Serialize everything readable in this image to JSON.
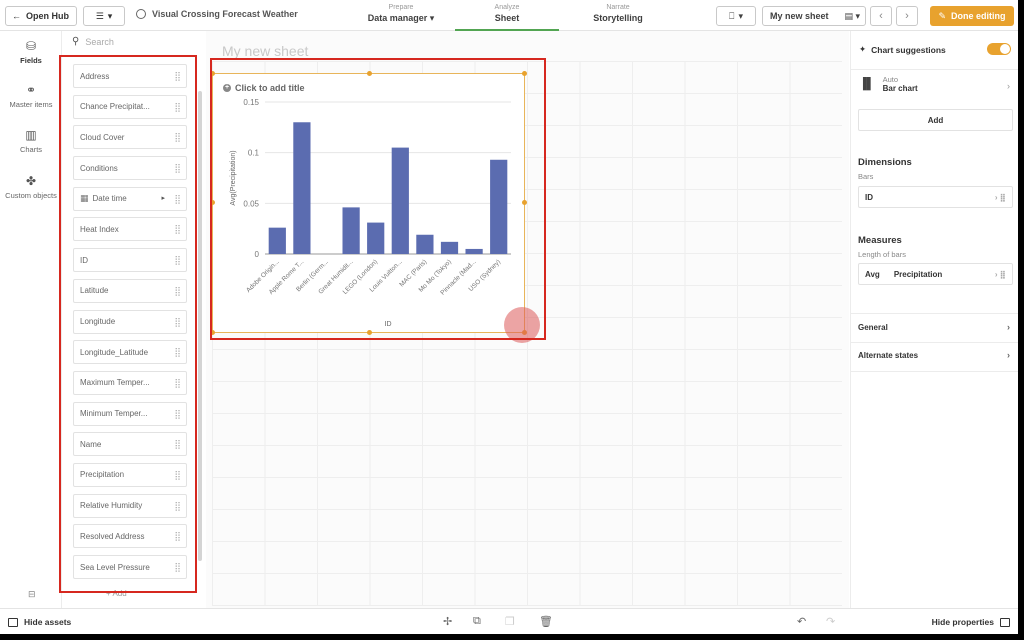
{
  "topbar": {
    "open_hub": "Open Hub",
    "app_title": "Visual Crossing Forecast Weather",
    "tabs": [
      {
        "small": "Prepare",
        "big": "Data manager",
        "caret": "▾"
      },
      {
        "small": "Analyze",
        "big": "Sheet"
      },
      {
        "small": "Narrate",
        "big": "Storytelling"
      }
    ],
    "sheet_name": "My new sheet",
    "done_editing": "Done editing"
  },
  "rail": {
    "items": [
      {
        "label": "Fields",
        "icon": "database-icon"
      },
      {
        "label": "Master items",
        "icon": "link-icon"
      },
      {
        "label": "Charts",
        "icon": "chart-icon"
      },
      {
        "label": "Custom objects",
        "icon": "puzzle-icon"
      }
    ]
  },
  "fields_panel": {
    "search_placeholder": "Search",
    "fields": [
      "Address",
      "Chance Precipitat...",
      "Cloud Cover",
      "Conditions",
      "Date time",
      "Heat Index",
      "ID",
      "Latitude",
      "Longitude",
      "Longitude_Latitude",
      "Maximum Temper...",
      "Minimum Temper...",
      "Name",
      "Precipitation",
      "Relative Humidity",
      "Resolved Address",
      "Sea Level Pressure"
    ],
    "add_label": "Add"
  },
  "canvas": {
    "sheet_title": "My new sheet",
    "chart_title_placeholder": "Click to add title"
  },
  "chart_data": {
    "type": "bar",
    "categories": [
      "Adobe Origin...",
      "Apple Rome T...",
      "Berlin (Germ...",
      "Great Humidit...",
      "LEGO (London)",
      "Louis Vuitton...",
      "MAC (Paris)",
      "Mo Mo (Tokyo)",
      "Pinnacle (Mad...",
      "USO (Sydney)"
    ],
    "values": [
      0.026,
      0.13,
      0.0,
      0.046,
      0.031,
      0.105,
      0.019,
      0.012,
      0.005,
      0.093
    ],
    "xlabel": "ID",
    "ylabel": "Avg(Precipitation)",
    "ylim": [
      0,
      0.15
    ],
    "yticks": [
      "0",
      "0.05",
      "0.1",
      "0.15"
    ],
    "bar_color": "#5b6cb0",
    "grid": true
  },
  "properties": {
    "chart_suggestions": "Chart suggestions",
    "chart_type_mode": "Auto",
    "chart_type": "Bar chart",
    "add_label": "Add",
    "dimensions_header": "Dimensions",
    "dimensions_sub": "Bars",
    "dimension_item": "ID",
    "measures_header": "Measures",
    "measures_sub": "Length of bars",
    "measure_agg": "Avg",
    "measure_field": "Precipitation",
    "general": "General",
    "alternate_states": "Alternate states"
  },
  "bottombar": {
    "hide_assets": "Hide assets",
    "hide_properties": "Hide properties"
  },
  "colors": {
    "accent_orange": "#e8a22e",
    "annotation_red": "#d6281f",
    "bar_blue": "#5b6cb0",
    "active_tab_green": "#52a552"
  }
}
